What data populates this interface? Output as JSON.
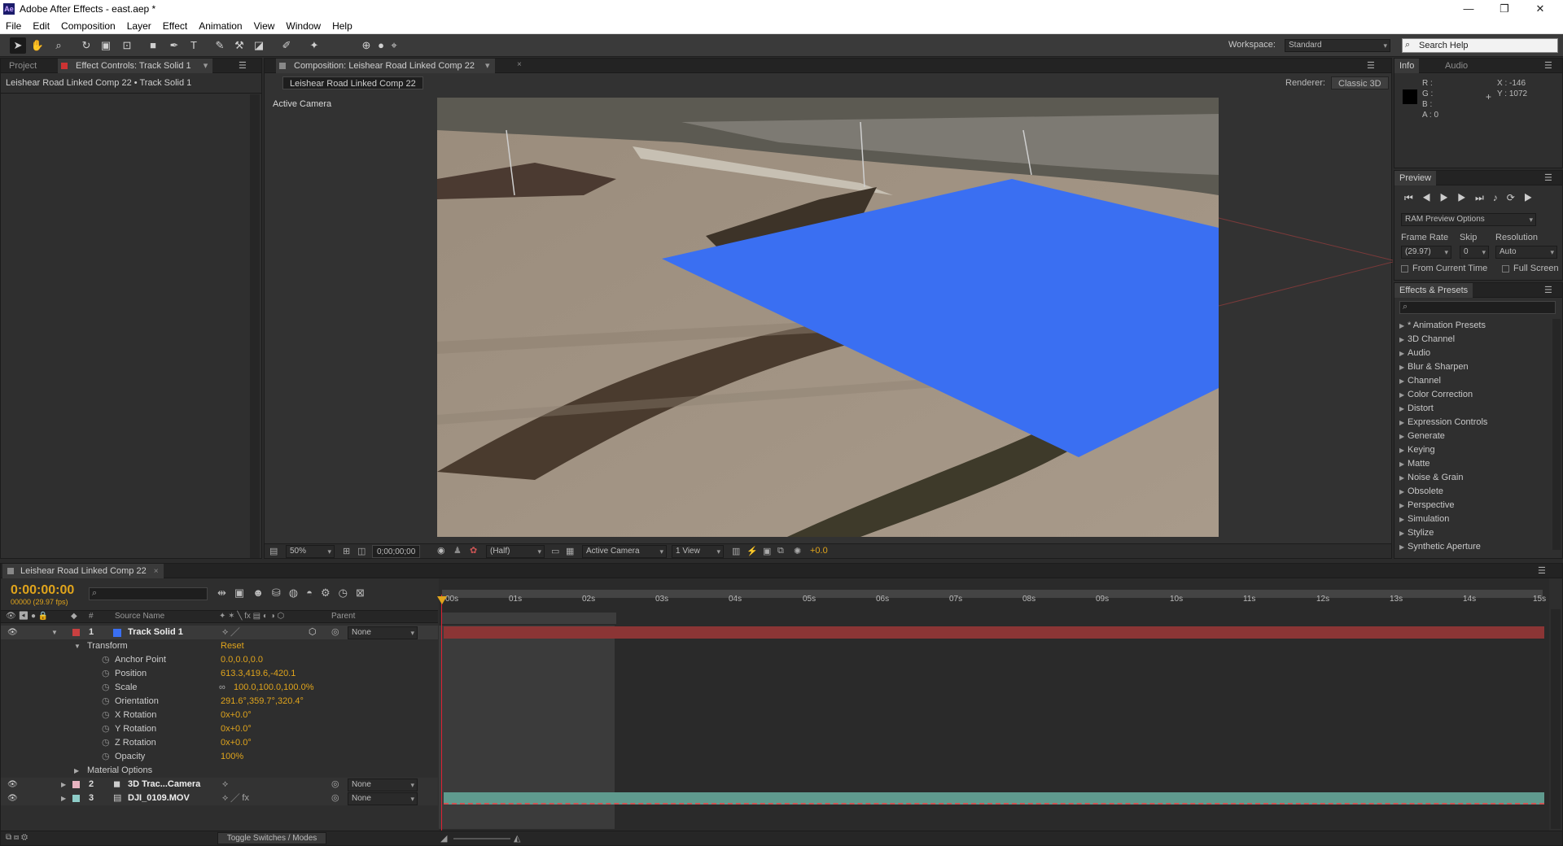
{
  "window": {
    "title": "Adobe After Effects - east.aep *",
    "app_icon_text": "Ae",
    "minimize": "—",
    "maximize": "❐",
    "close": "✕"
  },
  "menu": [
    "File",
    "Edit",
    "Composition",
    "Layer",
    "Effect",
    "Animation",
    "View",
    "Window",
    "Help"
  ],
  "toolbar": {
    "workspace_label": "Workspace:",
    "workspace_value": "Standard",
    "search_placeholder": "Search Help"
  },
  "left_panel": {
    "tab_project": "Project",
    "tab_effect_controls": "Effect Controls: Track Solid 1",
    "breadcrumb": "Leishear Road Linked Comp 22 • Track Solid 1"
  },
  "comp_panel": {
    "tab": "Composition: Leishear Road Linked Comp 22",
    "sub_tab": "Leishear Road Linked Comp 22",
    "renderer_label": "Renderer:",
    "renderer_value": "Classic 3D",
    "camera_label": "Active Camera",
    "zoom": "50%",
    "timecode": "0;00;00;00",
    "resolution": "(Half)",
    "view_camera": "Active Camera",
    "view_layout": "1 View",
    "exposure": "+0.0"
  },
  "info_panel": {
    "tab_info": "Info",
    "tab_audio": "Audio",
    "r": "R :",
    "g": "G :",
    "b": "B :",
    "a": "A : 0",
    "x": "X : -146",
    "y": "Y : 1072"
  },
  "preview_panel": {
    "tab": "Preview",
    "ram_options": "RAM Preview Options",
    "frame_rate_label": "Frame Rate",
    "skip_label": "Skip",
    "resolution_label": "Resolution",
    "frame_rate_value": "(29.97)",
    "skip_value": "0",
    "resolution_value": "Auto",
    "from_current_time": "From Current Time",
    "full_screen": "Full Screen"
  },
  "effects_panel": {
    "tab": "Effects & Presets",
    "items": [
      "* Animation Presets",
      "3D Channel",
      "Audio",
      "Blur & Sharpen",
      "Channel",
      "Color Correction",
      "Distort",
      "Expression Controls",
      "Generate",
      "Keying",
      "Matte",
      "Noise & Grain",
      "Obsolete",
      "Perspective",
      "Simulation",
      "Stylize",
      "Synthetic Aperture"
    ]
  },
  "timeline": {
    "tab": "Leishear Road Linked Comp 22",
    "timecode": "0:00:00:00",
    "frame_info": "00000 (29.97 fps)",
    "col_hash": "#",
    "col_source": "Source Name",
    "col_parent": "Parent",
    "ruler": [
      "00s",
      "01s",
      "02s",
      "03s",
      "04s",
      "05s",
      "06s",
      "07s",
      "08s",
      "09s",
      "10s",
      "11s",
      "12s",
      "13s",
      "14s",
      "15s"
    ],
    "layers": [
      {
        "num": "1",
        "name": "Track Solid 1",
        "parent": "None",
        "color": "#3a6ff2"
      },
      {
        "num": "2",
        "name": "3D Trac...Camera",
        "parent": "None",
        "color": "#e8b3c0"
      },
      {
        "num": "3",
        "name": "DJI_0109.MOV",
        "parent": "None",
        "color": "#8ecdc8"
      }
    ],
    "transform_label": "Transform",
    "transform_reset": "Reset",
    "props": [
      {
        "label": "Anchor Point",
        "value": "0.0,0.0,0.0"
      },
      {
        "label": "Position",
        "value": "613.3,419.6,-420.1"
      },
      {
        "label": "Scale",
        "value": "100.0,100.0,100.0%"
      },
      {
        "label": "Orientation",
        "value": "291.6°,359.7°,320.4°"
      },
      {
        "label": "X Rotation",
        "value": "0x+0.0°"
      },
      {
        "label": "Y Rotation",
        "value": "0x+0.0°"
      },
      {
        "label": "Z Rotation",
        "value": "0x+0.0°"
      },
      {
        "label": "Opacity",
        "value": "100%"
      }
    ],
    "material_options": "Material Options",
    "toggle_switches": "Toggle Switches / Modes"
  },
  "colors": {
    "accent_orange": "#e0a41c",
    "solid_blue": "#3a6ff2",
    "layer1_bar": "#8b3535",
    "layer3_bar": "#5f9a8e"
  }
}
